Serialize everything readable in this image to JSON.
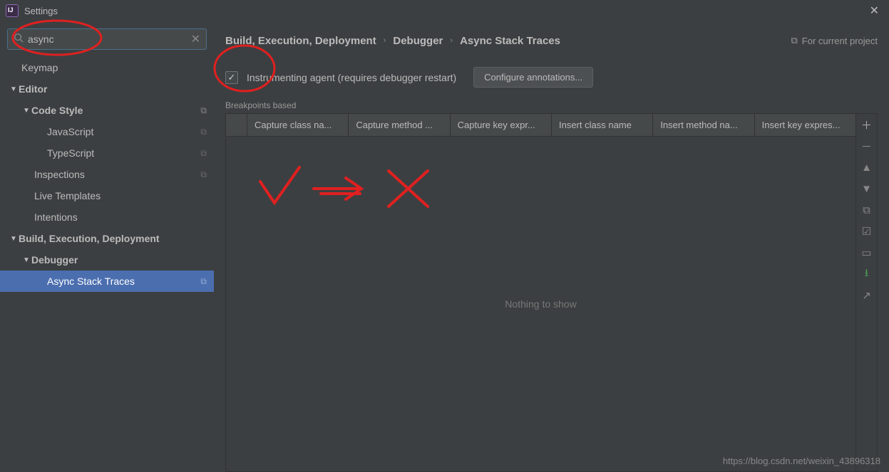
{
  "titlebar": {
    "title": "Settings"
  },
  "search": {
    "value": "async"
  },
  "tree": {
    "keymap": "Keymap",
    "editor": "Editor",
    "code_style": "Code Style",
    "javascript": "JavaScript",
    "typescript": "TypeScript",
    "inspections": "Inspections",
    "live_templates": "Live Templates",
    "intentions": "Intentions",
    "bed": "Build, Execution, Deployment",
    "debugger": "Debugger",
    "async": "Async Stack Traces"
  },
  "breadcrumb": {
    "c1": "Build, Execution, Deployment",
    "c2": "Debugger",
    "c3": "Async Stack Traces",
    "scope": "For current project"
  },
  "options": {
    "instrumenting": "Instrumenting agent (requires debugger restart)",
    "configure": "Configure annotations..."
  },
  "section": {
    "breakpoints": "Breakpoints based"
  },
  "columns": {
    "c1": "Capture class na...",
    "c2": "Capture method ...",
    "c3": "Capture key expr...",
    "c4": "Insert class name",
    "c5": "Insert method na...",
    "c6": "Insert key expres..."
  },
  "empty": "Nothing to show",
  "watermark": "https://blog.csdn.net/weixin_43896318"
}
